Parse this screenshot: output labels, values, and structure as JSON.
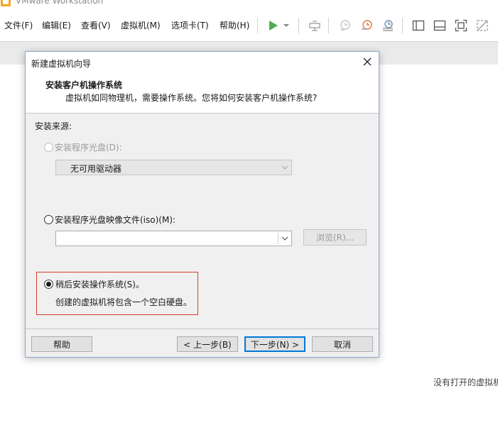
{
  "app": {
    "title": "VMware Workstation"
  },
  "menu": [
    "文件(F)",
    "编辑(E)",
    "查看(V)",
    "虚拟机(M)",
    "选项卡(T)",
    "帮助(H)"
  ],
  "toolbar": {
    "icons": [
      "play-icon",
      "dropdown-arrow-icon",
      "send-keys-icon",
      "snapshot-icon",
      "revert-snapshot-icon",
      "snapshot-manager-icon",
      "sidebar-toggle-icon",
      "thumbnail-bar-icon",
      "fullscreen-icon",
      "unity-icon"
    ],
    "accent": "#4caf50"
  },
  "status": {
    "no_vm": "没有打开的虚拟机"
  },
  "dialog": {
    "title": "新建虚拟机向导",
    "header_title": "安装客户机操作系统",
    "header_subtitle": "虚拟机如同物理机，需要操作系统。您将如何安装客户机操作系统?",
    "source_label": "安装来源:",
    "option_disc": {
      "label": "安装程序光盘(D):",
      "checked": false,
      "enabled": false
    },
    "disc_drive_value": "无可用驱动器",
    "option_iso": {
      "label": "安装程序光盘映像文件(iso)(M):",
      "checked": false,
      "enabled": true
    },
    "iso_path_value": "",
    "browse_button": "浏览(R)...",
    "option_later": {
      "label": "稍后安装操作系统(S)。",
      "checked": true,
      "enabled": true
    },
    "later_description": "创建的虚拟机将包含一个空白硬盘。",
    "buttons": {
      "help": "帮助",
      "back": "< 上一步(B)",
      "next": "下一步(N) >",
      "cancel": "取消"
    },
    "highlight_color": "#d83a2a"
  }
}
